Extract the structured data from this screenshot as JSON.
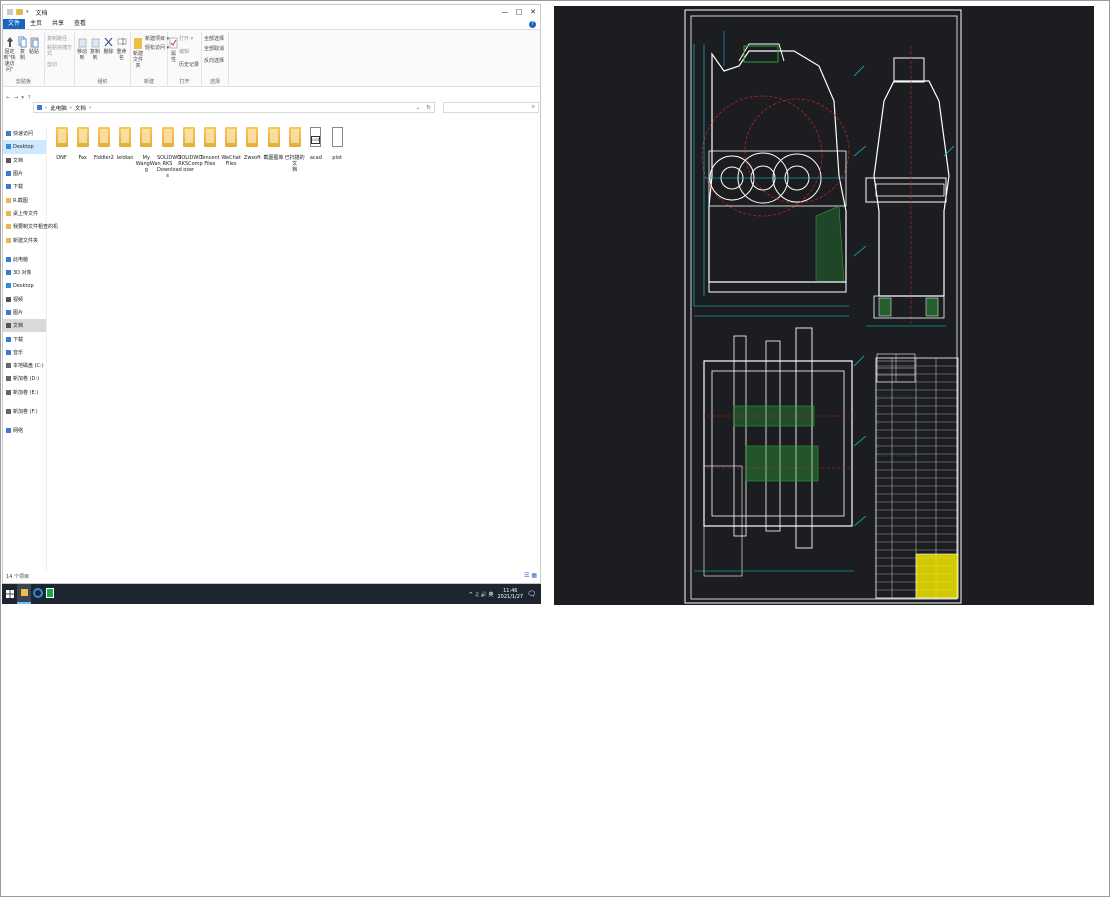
{
  "explorer": {
    "title": "文档",
    "window_controls": [
      "—",
      "□",
      "✕"
    ],
    "ribbon_tabs": [
      "文件",
      "主页",
      "共享",
      "查看"
    ],
    "ribbon": {
      "clipboard": {
        "pin_label": "固定到\"快速访问\"",
        "copy_label": "复制",
        "paste_label": "粘贴",
        "copy_path": "复制路径",
        "paste_shortcut": "粘贴快捷方式",
        "cut": "剪切",
        "group": "剪贴板"
      },
      "organize": {
        "move_to": "移动到",
        "copy_to": "复制到",
        "delete": "删除",
        "rename": "重命名",
        "group": "组织"
      },
      "new": {
        "new_folder": "新建\n文件夹",
        "new_item": "新建项目 ▾",
        "easy_access": "轻松访问 ▾",
        "group": "新建"
      },
      "open": {
        "properties": "属性",
        "open": "打开 ▾",
        "edit": "编辑",
        "history": "历史记录",
        "group": "打开"
      },
      "select": {
        "select_all": "全部选择",
        "select_none": "全部取消",
        "invert": "反向选择",
        "group": "选择"
      }
    },
    "breadcrumb": [
      "此电脑",
      "文档"
    ],
    "nav": [
      {
        "label": "快速访问",
        "type": "star"
      },
      {
        "label": "Desktop",
        "type": "desk",
        "selected": true
      },
      {
        "label": "文档",
        "type": "doc"
      },
      {
        "label": "图片",
        "type": "pic"
      },
      {
        "label": "下载",
        "type": "down"
      },
      {
        "label": "R.截图",
        "type": "folder"
      },
      {
        "label": "桌上传文件",
        "type": "folder"
      },
      {
        "label": "我要制文件粗查的机",
        "type": "folder"
      },
      {
        "label": "新建文件夹",
        "type": "folder"
      },
      {
        "label": "",
        "type": "gap"
      },
      {
        "label": "此电脑",
        "type": "pc"
      },
      {
        "label": "3D 对象",
        "type": "obj"
      },
      {
        "label": "Desktop",
        "type": "desk"
      },
      {
        "label": "视频",
        "type": "vid"
      },
      {
        "label": "图片",
        "type": "pic"
      },
      {
        "label": "文档",
        "type": "doc",
        "highlight": true
      },
      {
        "label": "下载",
        "type": "down"
      },
      {
        "label": "音乐",
        "type": "music"
      },
      {
        "label": "本地磁盘 (C:)",
        "type": "disk"
      },
      {
        "label": "新加卷 (D:)",
        "type": "disk"
      },
      {
        "label": "新加卷 (E:)",
        "type": "disk"
      },
      {
        "label": "",
        "type": "gap"
      },
      {
        "label": "新加卷 (F:)",
        "type": "disk"
      },
      {
        "label": "",
        "type": "gap"
      },
      {
        "label": "网络",
        "type": "net"
      }
    ],
    "files": [
      {
        "name": "DNF",
        "type": "folder"
      },
      {
        "name": "Fax",
        "type": "folder"
      },
      {
        "name": "Fiddler2",
        "type": "folder"
      },
      {
        "name": "leidian",
        "type": "folder"
      },
      {
        "name": "My\nWangWan\ng",
        "type": "folder"
      },
      {
        "name": "SOLIDWO\nRKS\nDownload\ns",
        "type": "folder"
      },
      {
        "name": "SOLIDWO\nRKSComp\noser",
        "type": "folder"
      },
      {
        "name": "Tencent\nFiles",
        "type": "folder"
      },
      {
        "name": "WeChat\nFiles",
        "type": "folder"
      },
      {
        "name": "Zwsoft",
        "type": "folder"
      },
      {
        "name": "截图图库",
        "type": "folder"
      },
      {
        "name": "已扫描的文\n档",
        "type": "folder"
      },
      {
        "name": "acad",
        "type": "lsp"
      },
      {
        "name": "plot",
        "type": "doc"
      }
    ],
    "status": "14 个项目",
    "lsp_badge": "LISP"
  },
  "taskbar": {
    "time": "11:46",
    "date": "2021/1/27",
    "tray": "^ ♫ 🔊 英"
  },
  "colors": {
    "accent": "#1a65c0",
    "taskbar": "#1d2530",
    "cad_bg": "#1b1d20",
    "cad_line": "#ffffff",
    "cad_cyan": "#18d0e8",
    "cad_red": "#d42424",
    "cad_green": "#2ea43c",
    "cad_yellow": "#f2e600"
  }
}
